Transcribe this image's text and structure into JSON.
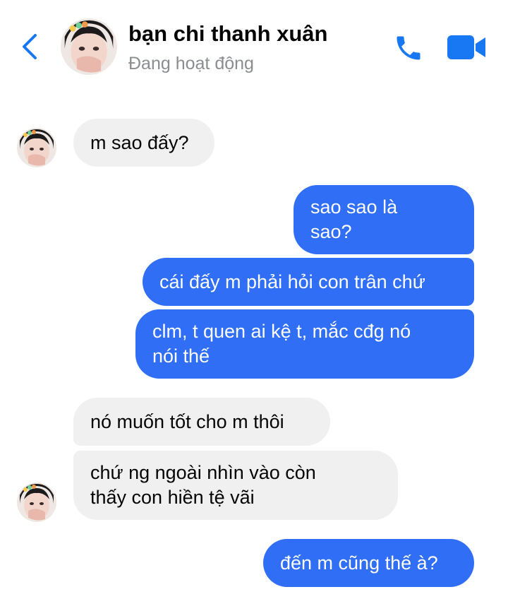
{
  "header": {
    "contact_name": "bạn chi thanh xuân",
    "status": "Đang hoạt động",
    "accent_color": "#1877f2"
  },
  "icons": {
    "back": "chevron-left-icon",
    "call": "phone-icon",
    "video": "video-camera-icon"
  },
  "colors": {
    "outgoing_bubble": "#2f6ef5",
    "incoming_bubble": "#f0f0f0"
  },
  "messages": [
    {
      "sender": "contact",
      "lines": [
        "m sao đấy?"
      ]
    },
    {
      "sender": "me",
      "lines": [
        "sao sao là",
        "sao?"
      ]
    },
    {
      "sender": "me",
      "lines": [
        "cái đấy m phải hỏi con trân chứ"
      ]
    },
    {
      "sender": "me",
      "lines": [
        "clm, t quen ai kệ t, mắc cđg nó",
        "nói thế"
      ]
    },
    {
      "sender": "contact",
      "lines": [
        "nó muốn tốt cho m thôi"
      ]
    },
    {
      "sender": "contact",
      "lines": [
        "chứ ng ngoài nhìn vào còn",
        "thấy con hiền tệ vãi"
      ]
    },
    {
      "sender": "me",
      "lines": [
        "đến m cũng thế à?"
      ]
    }
  ]
}
